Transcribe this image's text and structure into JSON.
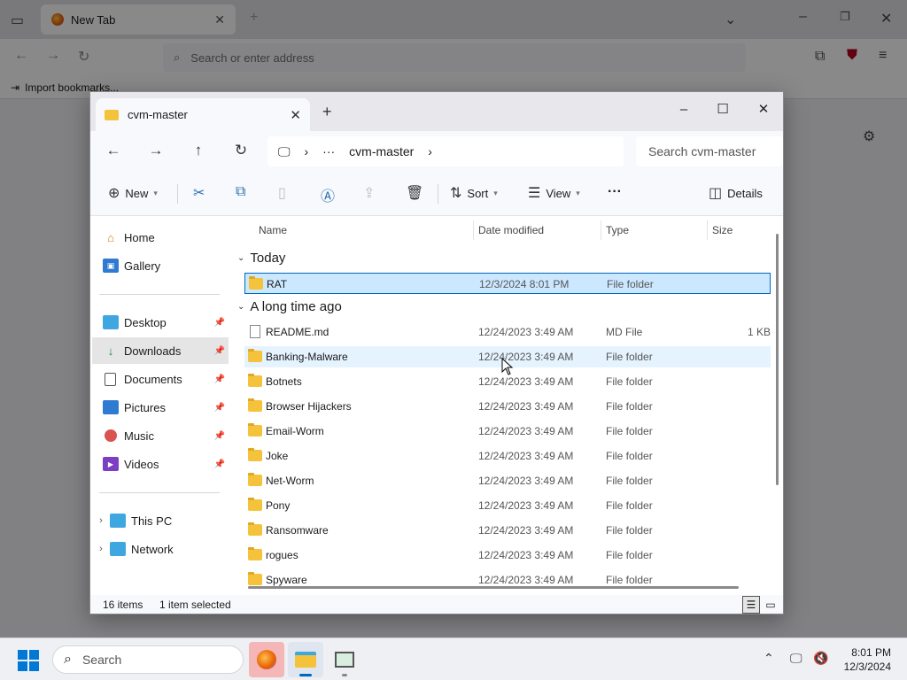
{
  "browser": {
    "tab_title": "New Tab",
    "address_placeholder": "Search or enter address",
    "bookmark_label": "Import bookmarks..."
  },
  "explorer": {
    "tab_title": "cvm-master",
    "path_current": "cvm-master",
    "search_placeholder": "Search cvm-master",
    "toolbar": {
      "new_label": "New",
      "sort_label": "Sort",
      "view_label": "View",
      "details_label": "Details"
    },
    "nav": [
      {
        "label": "Home",
        "icon": "home-icon"
      },
      {
        "label": "Gallery",
        "icon": "gallery-icon"
      },
      {
        "label": "Desktop",
        "icon": "desktop-icon",
        "pinned": true
      },
      {
        "label": "Downloads",
        "icon": "downloads-icon",
        "pinned": true,
        "selected": true
      },
      {
        "label": "Documents",
        "icon": "documents-icon",
        "pinned": true
      },
      {
        "label": "Pictures",
        "icon": "pictures-icon",
        "pinned": true
      },
      {
        "label": "Music",
        "icon": "music-icon",
        "pinned": true
      },
      {
        "label": "Videos",
        "icon": "videos-icon",
        "pinned": true
      },
      {
        "label": "This PC",
        "icon": "this-pc-icon"
      },
      {
        "label": "Network",
        "icon": "network-icon"
      }
    ],
    "columns": {
      "name": "Name",
      "date": "Date modified",
      "type": "Type",
      "size": "Size"
    },
    "groups": {
      "today": "Today",
      "older": "A long time ago"
    },
    "files_today": [
      {
        "name": "RAT",
        "date": "12/3/2024 8:01 PM",
        "type": "File folder",
        "size": "",
        "selected": true
      }
    ],
    "files_older": [
      {
        "name": "README.md",
        "date": "12/24/2023 3:49 AM",
        "type": "MD File",
        "size": "1 KB",
        "kind": "file"
      },
      {
        "name": "Banking-Malware",
        "date": "12/24/2023 3:49 AM",
        "type": "File folder",
        "size": "",
        "kind": "folder",
        "hover": true
      },
      {
        "name": "Botnets",
        "date": "12/24/2023 3:49 AM",
        "type": "File folder",
        "size": "",
        "kind": "folder"
      },
      {
        "name": "Browser Hijackers",
        "date": "12/24/2023 3:49 AM",
        "type": "File folder",
        "size": "",
        "kind": "folder"
      },
      {
        "name": "Email-Worm",
        "date": "12/24/2023 3:49 AM",
        "type": "File folder",
        "size": "",
        "kind": "folder"
      },
      {
        "name": "Joke",
        "date": "12/24/2023 3:49 AM",
        "type": "File folder",
        "size": "",
        "kind": "folder"
      },
      {
        "name": "Net-Worm",
        "date": "12/24/2023 3:49 AM",
        "type": "File folder",
        "size": "",
        "kind": "folder"
      },
      {
        "name": "Pony",
        "date": "12/24/2023 3:49 AM",
        "type": "File folder",
        "size": "",
        "kind": "folder"
      },
      {
        "name": "Ransomware",
        "date": "12/24/2023 3:49 AM",
        "type": "File folder",
        "size": "",
        "kind": "folder"
      },
      {
        "name": "rogues",
        "date": "12/24/2023 3:49 AM",
        "type": "File folder",
        "size": "",
        "kind": "folder"
      },
      {
        "name": "Spyware",
        "date": "12/24/2023 3:49 AM",
        "type": "File folder",
        "size": "",
        "kind": "folder"
      }
    ],
    "status": {
      "items": "16 items",
      "selected": "1 item selected"
    }
  },
  "taskbar": {
    "search_placeholder": "Search",
    "time": "8:01 PM",
    "date": "12/3/2024"
  }
}
